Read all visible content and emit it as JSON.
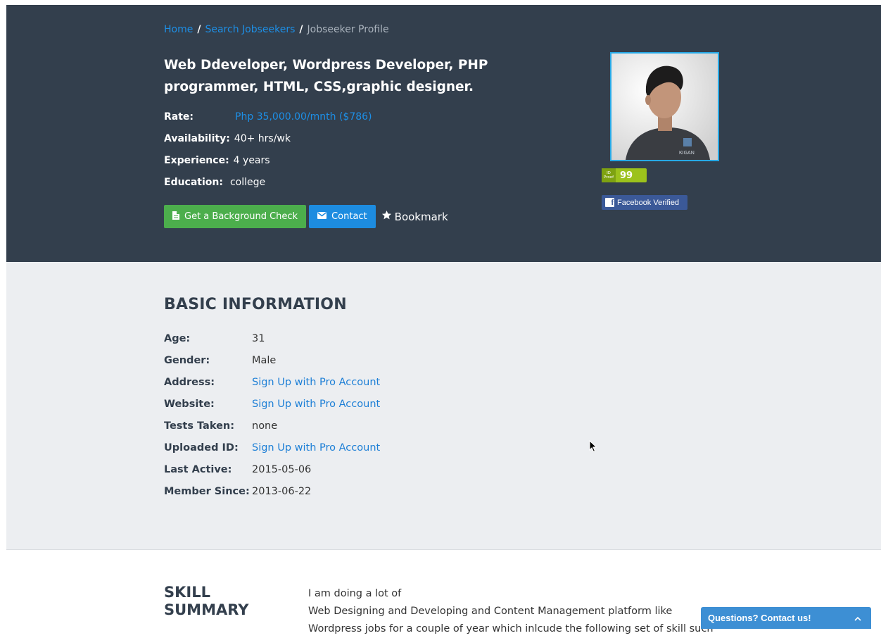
{
  "breadcrumb": {
    "home": "Home",
    "search": "Search Jobseekers",
    "current": "Jobseeker Profile",
    "separator": "/"
  },
  "profile": {
    "title": "Web Ddeveloper, Wordpress Developer, PHP programmer, HTML, CSS,graphic designer.",
    "summary": [
      {
        "label": "Rate:",
        "value": "Php 35,000.00/mnth ($786)"
      },
      {
        "label": "Availability:",
        "value": "40+ hrs/wk"
      },
      {
        "label": "Experience:",
        "value": "4 years"
      },
      {
        "label": "Education:",
        "value": "college"
      }
    ],
    "id_proof_label_top": "ID",
    "id_proof_label_bottom": "Proof",
    "id_proof_score": "99",
    "facebook_verified": "Facebook Verified"
  },
  "actions": {
    "background_check": "Get a Background Check",
    "contact": "Contact",
    "bookmark": "Bookmark"
  },
  "basic_info": {
    "title": "BASIC INFORMATION",
    "rows": [
      {
        "label": "Age:",
        "value": "31"
      },
      {
        "label": "Gender:",
        "value": "Male"
      },
      {
        "label": "Address:",
        "value": "Sign Up with Pro Account"
      },
      {
        "label": "Website:",
        "value": "Sign Up with Pro Account"
      },
      {
        "label": "Tests Taken:",
        "value": "none"
      },
      {
        "label": "Uploaded ID:",
        "value": "Sign Up with Pro Account"
      },
      {
        "label": "Last Active:",
        "value": "2015-05-06"
      },
      {
        "label": "Member Since:",
        "value": "2013-06-22"
      }
    ]
  },
  "skill_summary": {
    "title_line1": "SKILL",
    "title_line2": "SUMMARY",
    "lines": [
      "I am doing a lot of",
      "Web Designing and Developing and Content Management platform like",
      "Wordpress jobs for a couple of year which inlcude the following set of skill such"
    ]
  },
  "chat": {
    "label": "Questions? Contact us!"
  },
  "colors": {
    "hero_bg": "#333f4d",
    "info_bg": "#eceef1",
    "link": "#1d8fe6",
    "green_button": "#4cae4c",
    "blue_button": "#1d8ce0"
  }
}
